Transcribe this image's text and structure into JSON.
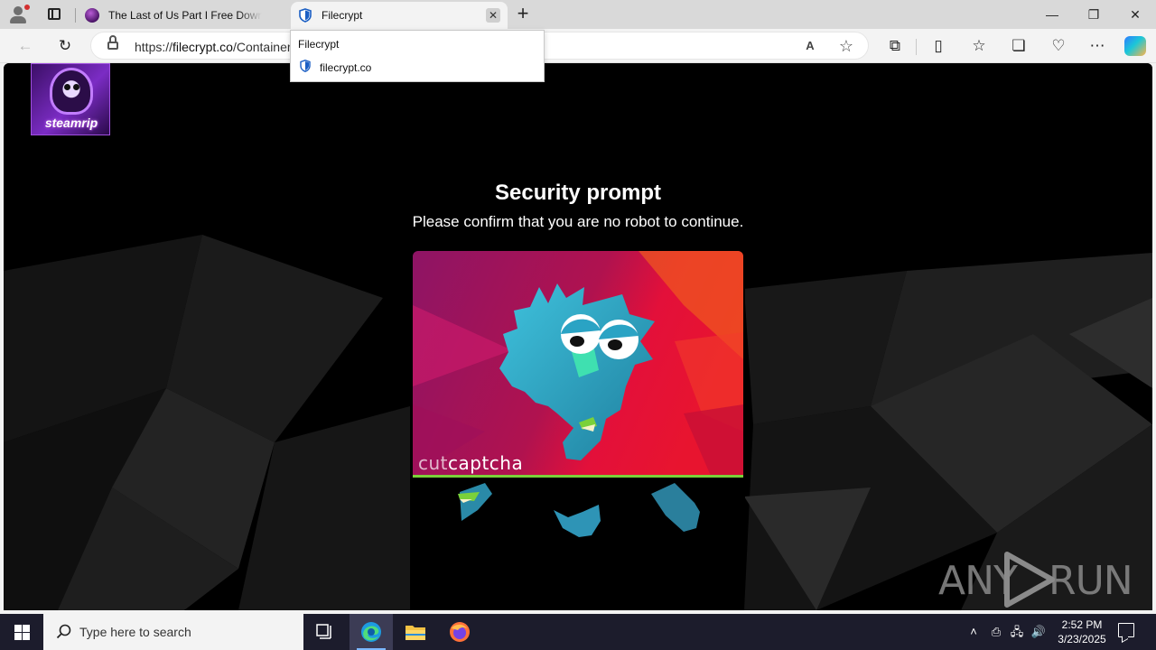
{
  "browser": {
    "tabs": [
      {
        "label": "The Last of Us Part I Free Download",
        "active": false
      },
      {
        "label": "Filecrypt",
        "active": true
      }
    ],
    "close_glyph": "✕",
    "new_tab_glyph": "+",
    "window_controls": {
      "minimize": "—",
      "restore": "❐",
      "close": "✕"
    },
    "address": {
      "scheme": "https://",
      "host": "filecrypt.co",
      "path": "/Container"
    },
    "tooltip": {
      "title": "Filecrypt",
      "host": "filecrypt.co"
    }
  },
  "page": {
    "logo_text": "steamrip",
    "heading": "Security prompt",
    "subheading": "Please confirm that you are no robot to continue.",
    "captcha": {
      "brand_light": "cut",
      "brand_main": "captcha",
      "pieces": [
        "piece-1",
        "piece-2",
        "piece-3"
      ],
      "colors": {
        "magenta": "#9b1a6e",
        "red": "#e01438",
        "mascot": "#2aa3c4",
        "accent_green": "#7ad13a"
      }
    },
    "watermark": {
      "left": "ANY",
      "right": "RUN"
    }
  },
  "taskbar": {
    "search_placeholder": "Type here to search",
    "time": "2:52 PM",
    "date": "3/23/2025"
  }
}
